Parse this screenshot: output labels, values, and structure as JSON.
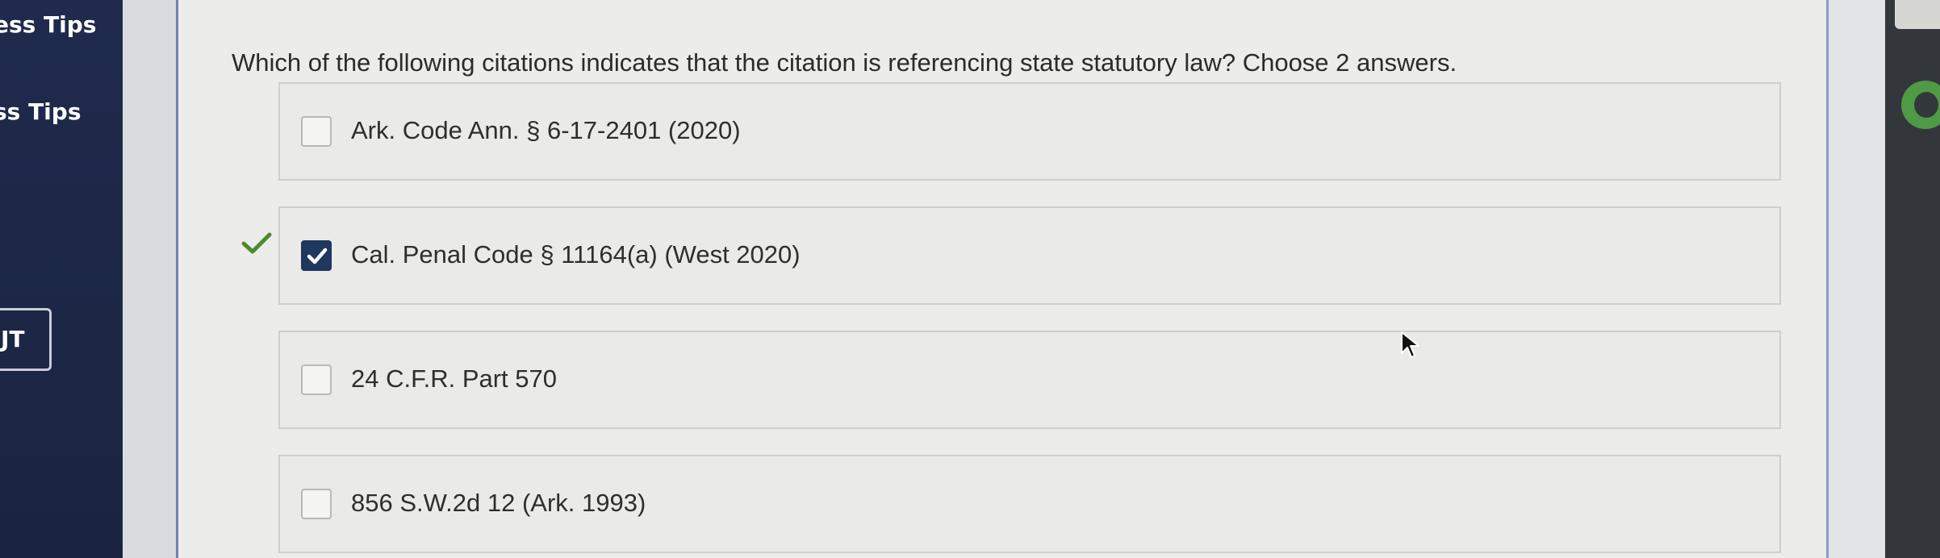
{
  "sidebar": {
    "tabs": [
      {
        "label": "ess Tips"
      },
      {
        "label": "ss Tips"
      }
    ],
    "button_label": "JT"
  },
  "question": {
    "text": "Which of the following citations indicates that the citation is referencing state statutory law? Choose 2 answers."
  },
  "options": [
    {
      "label": "Ark. Code Ann. § 6-17-2401 (2020)",
      "checked": false
    },
    {
      "label": "Cal. Penal Code § 11164(a) (West 2020)",
      "checked": true,
      "marked_correct": true
    },
    {
      "label": "24 C.F.R. Part 570",
      "checked": false
    },
    {
      "label": "856 S.W.2d 12 (Ark. 1993)",
      "checked": false
    }
  ],
  "colors": {
    "sidebar": "#1f2a4d",
    "checkbox_checked": "#20375e",
    "correct_check": "#4c8a2e"
  },
  "icons": {
    "correct": "check-mark-icon",
    "cursor": "mouse-pointer-icon"
  }
}
